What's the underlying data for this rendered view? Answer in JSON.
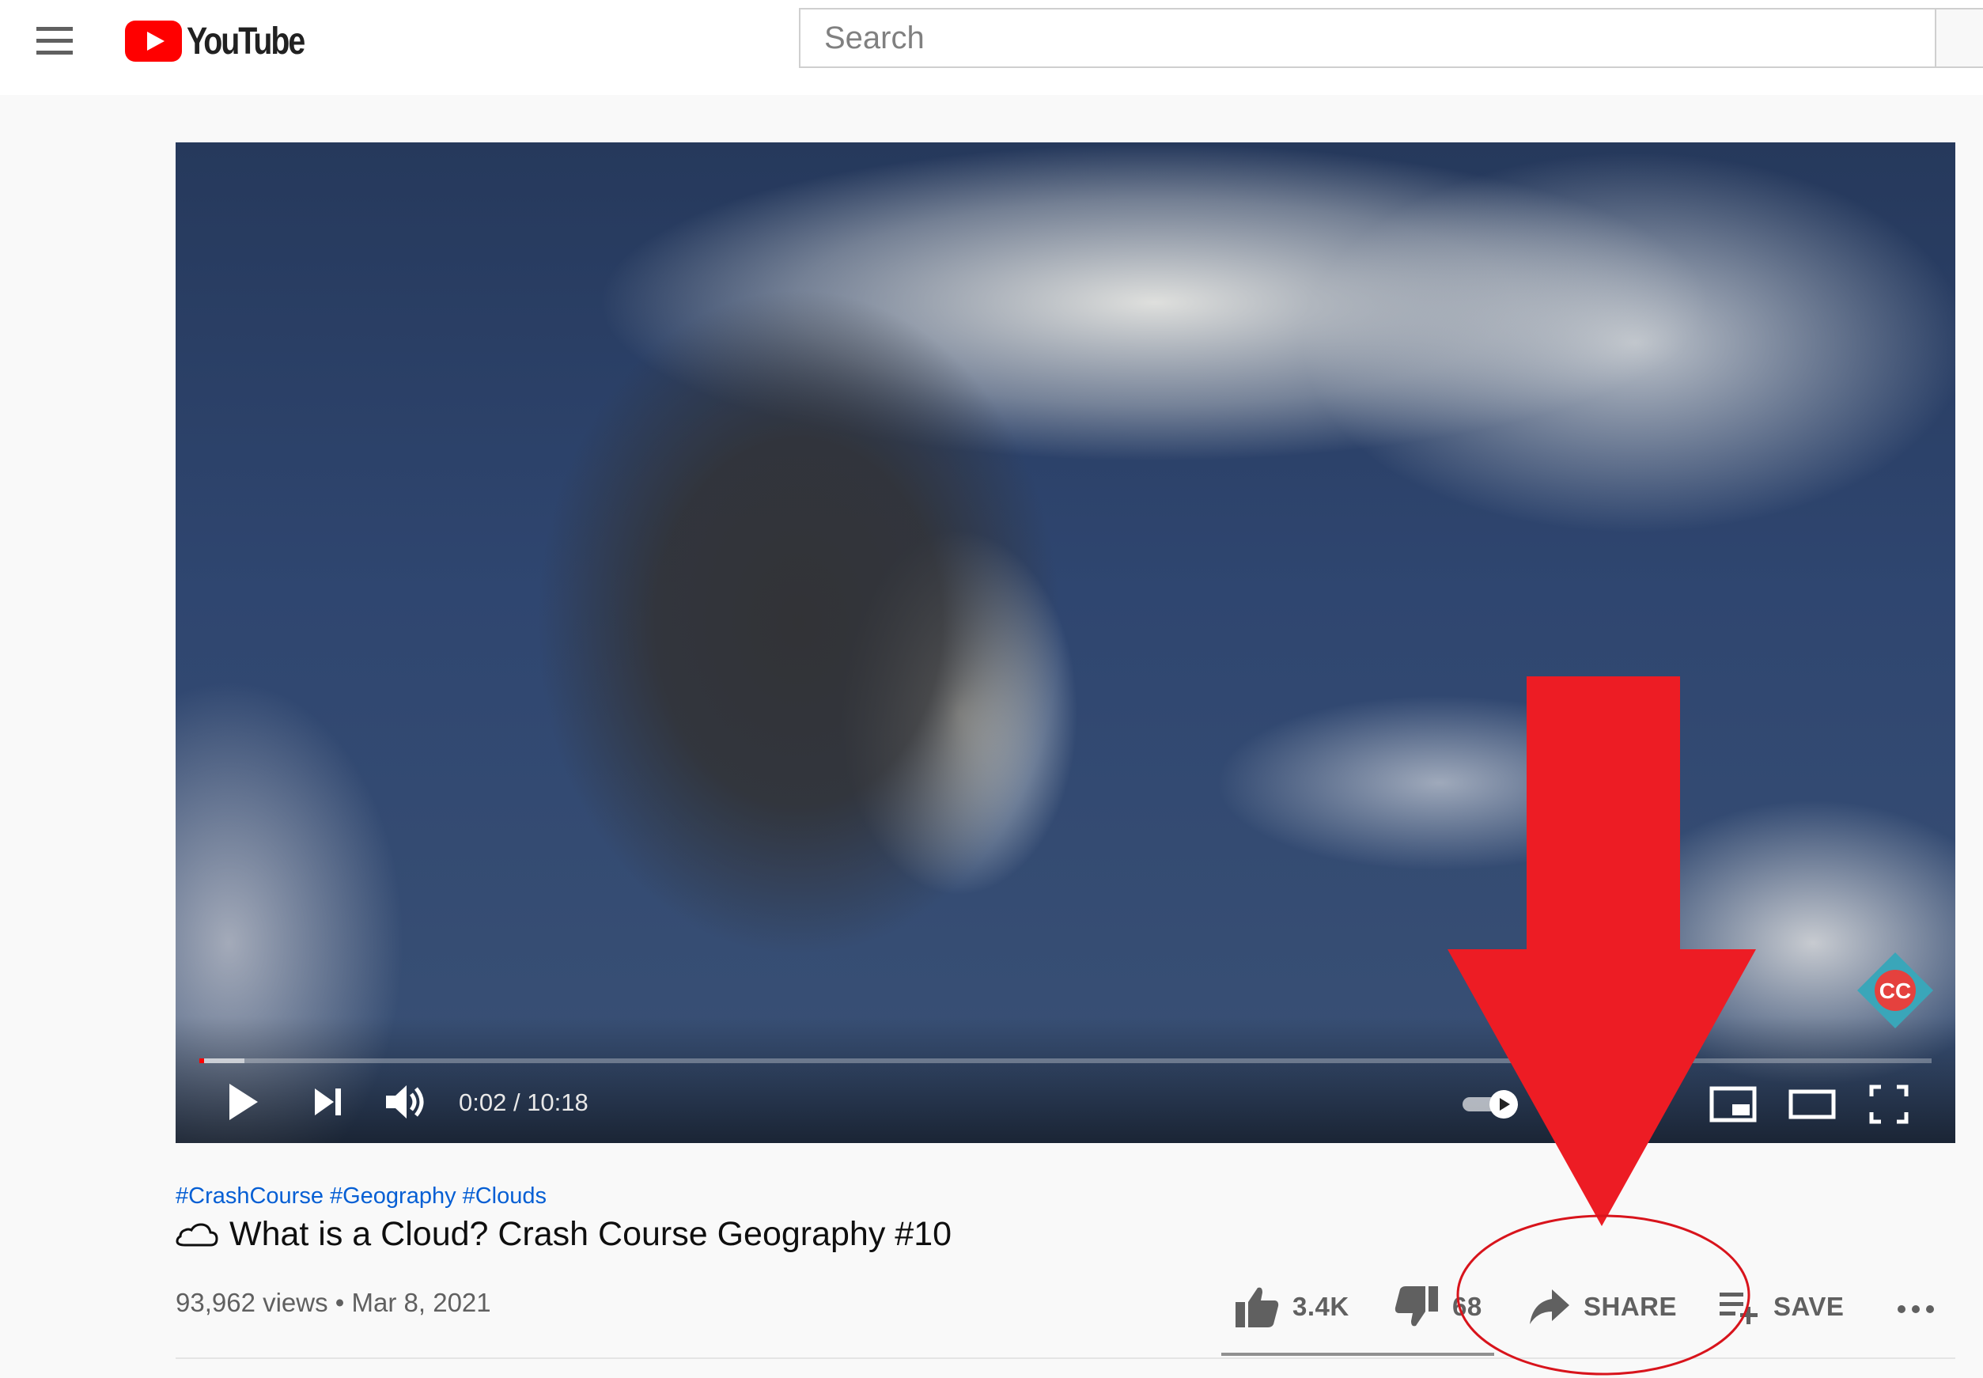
{
  "header": {
    "logo_text": "YouTube",
    "search_placeholder": "Search"
  },
  "player": {
    "time_display": "0:02 / 10:18",
    "progress_played_fraction": 0.0016,
    "progress_buffered_fraction": 0.026,
    "channel_badge_text": "CC",
    "colors": {
      "progress": "#ff0000",
      "brand_red": "#ff0000"
    }
  },
  "video": {
    "hashtags": [
      "#CrashCourse",
      "#Geography",
      "#Clouds"
    ],
    "title": "What is a Cloud? Crash Course Geography #10",
    "views": "93,962 views",
    "separator": "•",
    "date": "Mar 8, 2021"
  },
  "actions": {
    "like_count": "3.4K",
    "dislike_count": "68",
    "share_label": "SHARE",
    "save_label": "SAVE"
  },
  "annotation": {
    "color": "#ed1c24",
    "arrow_icon": "down-arrow",
    "highlight": "share-button"
  }
}
